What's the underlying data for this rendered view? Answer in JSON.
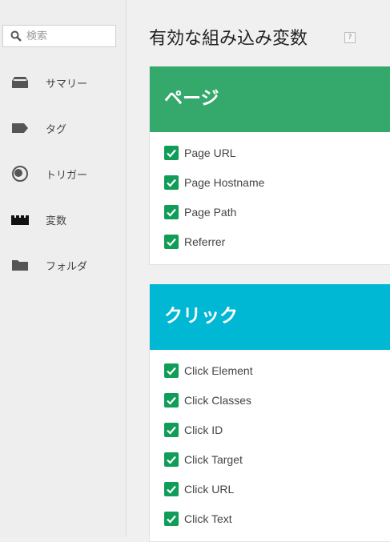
{
  "search": {
    "placeholder": "検索"
  },
  "sidebar": {
    "items": [
      {
        "label": "サマリー",
        "icon": "summary-icon"
      },
      {
        "label": "タグ",
        "icon": "tag-icon"
      },
      {
        "label": "トリガー",
        "icon": "trigger-icon"
      },
      {
        "label": "変数",
        "icon": "variables-icon"
      },
      {
        "label": "フォルダ",
        "icon": "folder-icon"
      }
    ]
  },
  "main": {
    "title": "有効な組み込み変数",
    "help_icon": "?",
    "sections": [
      {
        "title": "ページ",
        "color": "#34a96b",
        "variables": [
          "Page URL",
          "Page Hostname",
          "Page Path",
          "Referrer"
        ]
      },
      {
        "title": "クリック",
        "color": "#00b8d4",
        "variables": [
          "Click Element",
          "Click Classes",
          "Click ID",
          "Click Target",
          "Click URL",
          "Click Text"
        ]
      }
    ]
  },
  "colors": {
    "checkbox": "#0f9d58",
    "icon": "#555555"
  }
}
